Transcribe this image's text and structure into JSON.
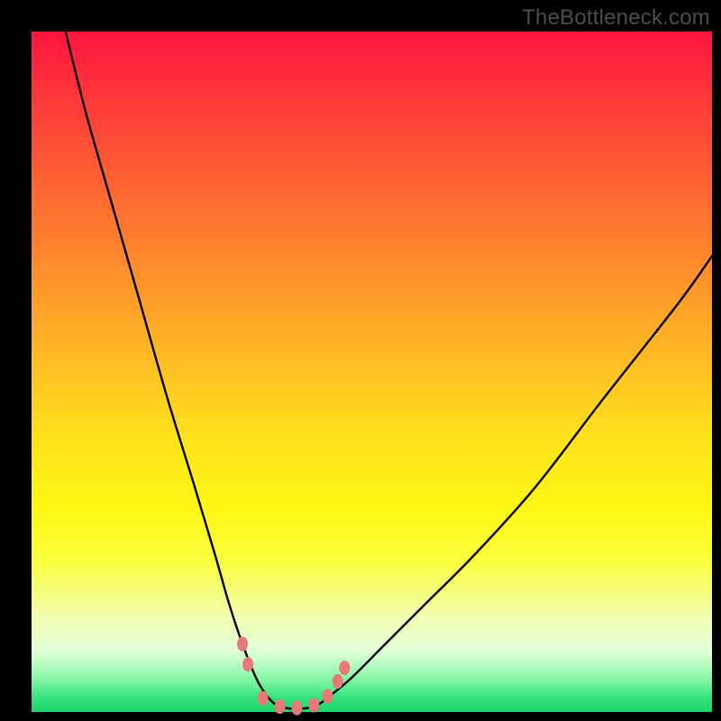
{
  "watermark": "TheBottleneck.com",
  "colors": {
    "frame": "#000000",
    "curve": "#000000",
    "marker": "#e77a78",
    "text": "#4d4d4d"
  },
  "chart_data": {
    "type": "line",
    "title": "",
    "xlabel": "",
    "ylabel": "",
    "xlim": [
      0,
      100
    ],
    "ylim": [
      0,
      100
    ],
    "series": [
      {
        "name": "bottleneck-curve",
        "x": [
          5,
          8,
          12,
          16,
          20,
          24,
          27,
          29,
          31,
          33,
          34.5,
          36,
          38,
          40,
          42,
          44,
          47,
          52,
          58,
          65,
          74,
          84,
          95,
          100
        ],
        "y": [
          100,
          88,
          74,
          60,
          46,
          33,
          23,
          16,
          10,
          5,
          2.5,
          1,
          0.5,
          0.5,
          1,
          2.5,
          5,
          10,
          16,
          23,
          33,
          46,
          60,
          67
        ]
      }
    ],
    "markers": {
      "name": "highlight-points",
      "x": [
        31.0,
        31.8,
        34.0,
        36.5,
        39.0,
        41.5,
        43.5,
        45.0,
        46.0
      ],
      "y": [
        10.0,
        7.0,
        2.0,
        0.8,
        0.6,
        1.0,
        2.3,
        4.5,
        6.5
      ],
      "size": 12
    }
  }
}
